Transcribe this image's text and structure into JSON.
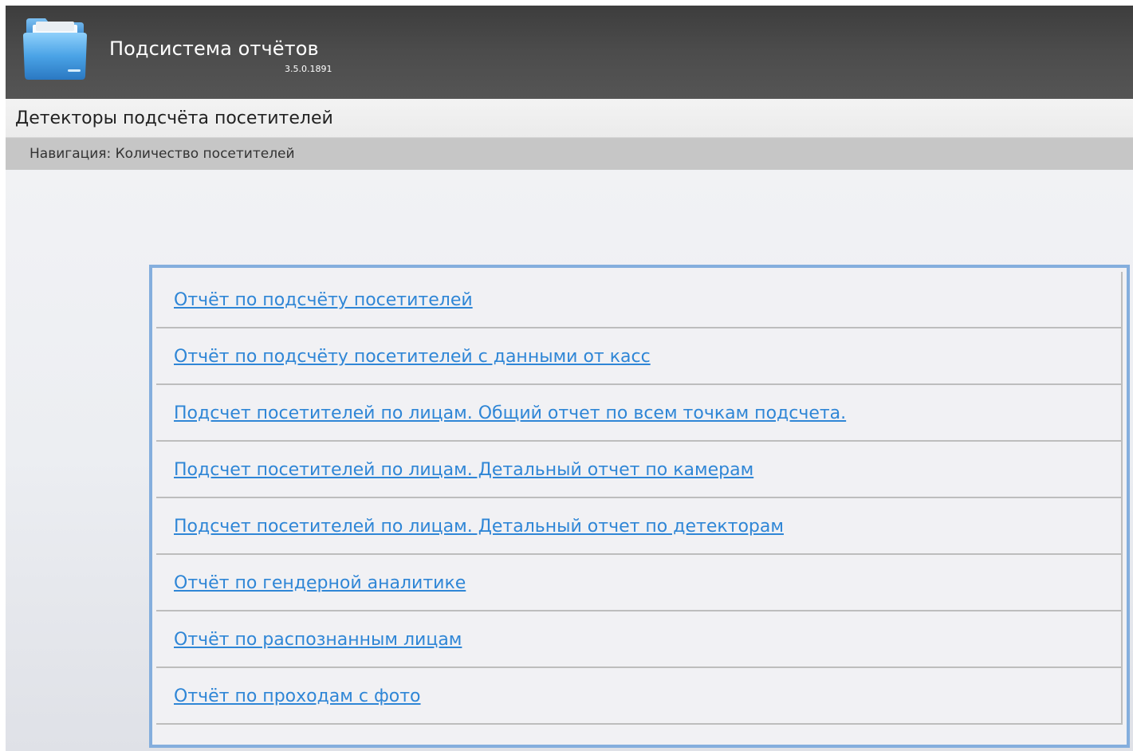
{
  "header": {
    "title": "Подсистема отчётов",
    "version": "3.5.0.1891",
    "logo_icon": "folder-icon"
  },
  "section": {
    "title": "Детекторы подсчёта посетителей"
  },
  "breadcrumb": {
    "text": "Навигация: Количество посетителей"
  },
  "reports": [
    {
      "label": "Отчёт по подсчёту посетителей"
    },
    {
      "label": "Отчёт по подсчёту посетителей с данными от касс"
    },
    {
      "label": "Подсчет посетителей по лицам. Общий отчет по всем точкам подсчета."
    },
    {
      "label": "Подсчет посетителей по лицам. Детальный отчет по камерам"
    },
    {
      "label": "Подсчет посетителей по лицам. Детальный отчет по детекторам"
    },
    {
      "label": "Отчёт по гендерной аналитике"
    },
    {
      "label": "Отчёт по распознанным лицам"
    },
    {
      "label": "Отчёт по проходам с фото"
    }
  ],
  "colors": {
    "link": "#2f86d6",
    "panel_border": "#84aedd",
    "header_bg": "#474747",
    "breadcrumb_bg": "#c6c6c6"
  }
}
